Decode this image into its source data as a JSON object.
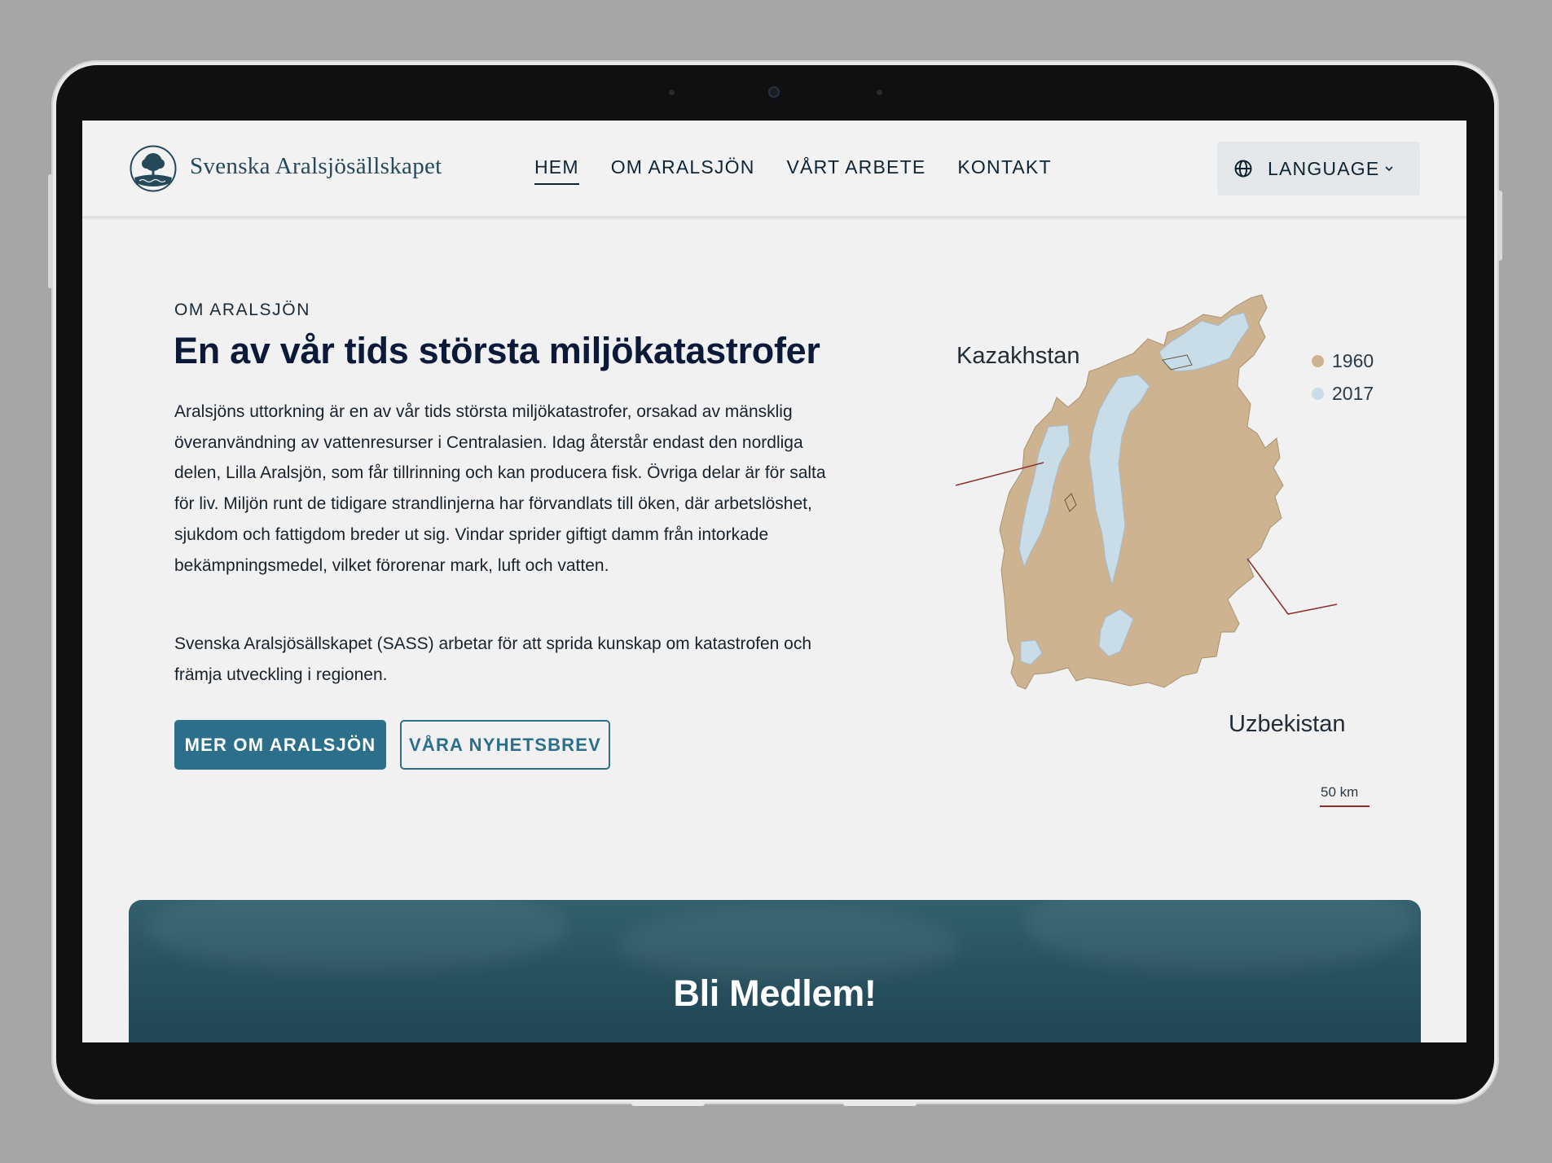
{
  "header": {
    "brand": "Svenska Aralsjösällskapet",
    "nav": [
      {
        "label": "HEM",
        "active": true
      },
      {
        "label": "OM ARALSJÖN",
        "active": false
      },
      {
        "label": "VÅRT ARBETE",
        "active": false
      },
      {
        "label": "KONTAKT",
        "active": false
      }
    ],
    "language_label": "LANGUAGE",
    "language_icon": "globe-icon",
    "chevron_icon": "chevron-down-icon"
  },
  "hero": {
    "eyebrow": "OM ARALSJÖN",
    "title": "En av vår tids största miljökatastrofer",
    "paragraph1": "Aralsjöns uttorkning är en av vår tids största miljökatastrofer, orsakad av mänsklig överanvändning av vattenresurser i Centralasien. Idag återstår endast den nordliga delen, Lilla Aralsjön, som får tillrinning och kan producera fisk. Övriga delar är för salta för liv. Miljön runt de tidigare strandlinjerna har förvandlats till öken, där arbetslöshet, sjukdom och fattigdom breder ut sig. Vindar sprider giftigt damm från intorkade bekämpningsmedel, vilket förorenar mark, luft och vatten.",
    "paragraph2": "Svenska Aralsjösällskapet (SASS) arbetar för att sprida kunskap om katastrofen och främja utveckling i regionen.",
    "button_primary": "MER OM ARALSJÖN",
    "button_secondary": "VÅRA NYHETSBREV"
  },
  "map": {
    "label_north": "Kazakhstan",
    "label_south": "Uzbekistan",
    "legend": [
      {
        "label": "1960",
        "color": "#cdb38f"
      },
      {
        "label": "2017",
        "color": "#c9dde8"
      }
    ],
    "scale": "50 km",
    "line_color": "#8b2f2f"
  },
  "banner": {
    "title": "Bli Medlem!"
  },
  "colors": {
    "accent": "#2b6f8a",
    "navy": "#0c1a3a",
    "banner": "#28505e"
  }
}
